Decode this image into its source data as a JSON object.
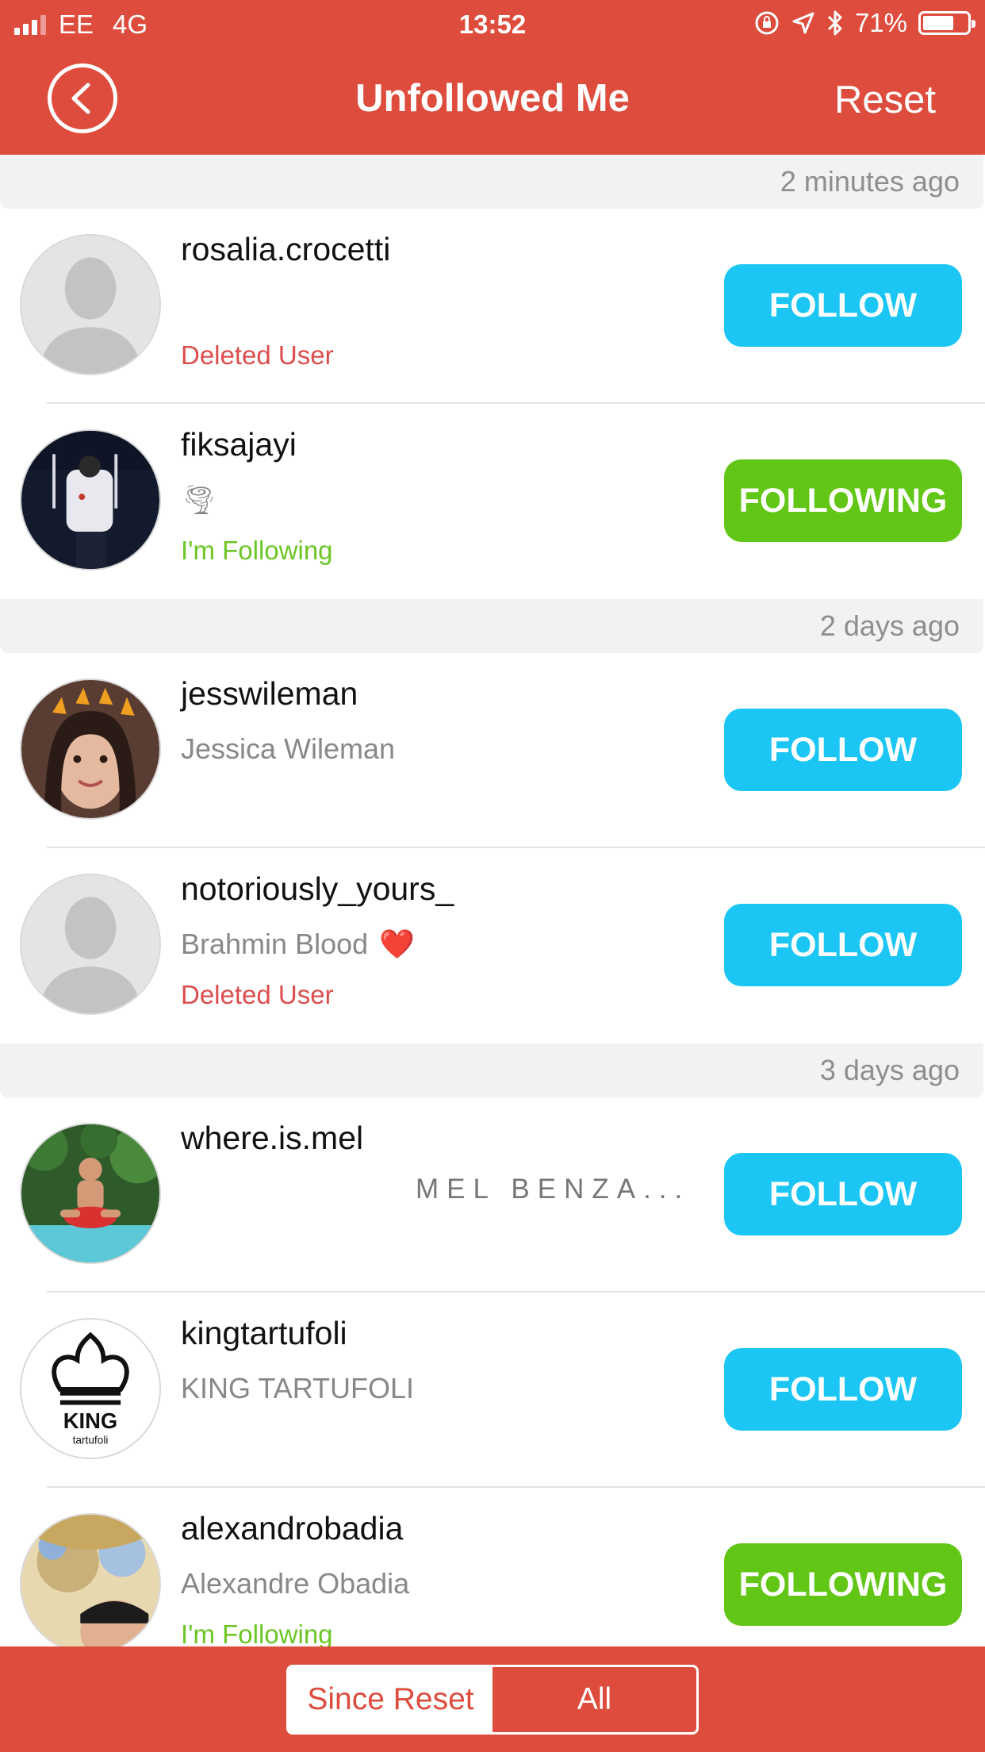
{
  "status_bar": {
    "carrier": "EE",
    "network": "4G",
    "time": "13:52",
    "battery": "71%"
  },
  "header": {
    "title": "Unfollowed Me",
    "reset_label": "Reset"
  },
  "sections": [
    {
      "time_label": "2 minutes ago",
      "users": [
        {
          "username": "rosalia.crocetti",
          "full_name": "",
          "status": "Deleted User",
          "button": "FOLLOW"
        },
        {
          "username": "fiksajayi",
          "full_name": "🌪",
          "status": "I'm Following",
          "button": "FOLLOWING"
        }
      ]
    },
    {
      "time_label": "2 days ago",
      "users": [
        {
          "username": "jesswileman",
          "full_name": "Jessica Wileman",
          "status": "",
          "button": "FOLLOW"
        },
        {
          "username": "notoriously_yours_",
          "full_name": "Brahmin Blood",
          "emoji": "❤️",
          "status": "Deleted User",
          "button": "FOLLOW"
        }
      ]
    },
    {
      "time_label": "3 days ago",
      "users": [
        {
          "username": "where.is.mel",
          "full_name": "MEL BENZA...",
          "status": "",
          "button": "FOLLOW"
        },
        {
          "username": "kingtartufoli",
          "full_name": "KING TARTUFOLI",
          "status": "",
          "button": "FOLLOW"
        },
        {
          "username": "alexandrobadia",
          "full_name": "Alexandre Obadia",
          "status": "I'm Following",
          "button": "FOLLOWING"
        }
      ]
    }
  ],
  "logo_text": {
    "king": "KING",
    "tartufoli": "tartufoli"
  },
  "bottom_tabs": {
    "since_reset": "Since Reset",
    "all": "All"
  },
  "colors": {
    "header": "#dd4c3c",
    "follow": "#1bc6f4",
    "following": "#62c617",
    "deleted": "#dc4d4d"
  }
}
